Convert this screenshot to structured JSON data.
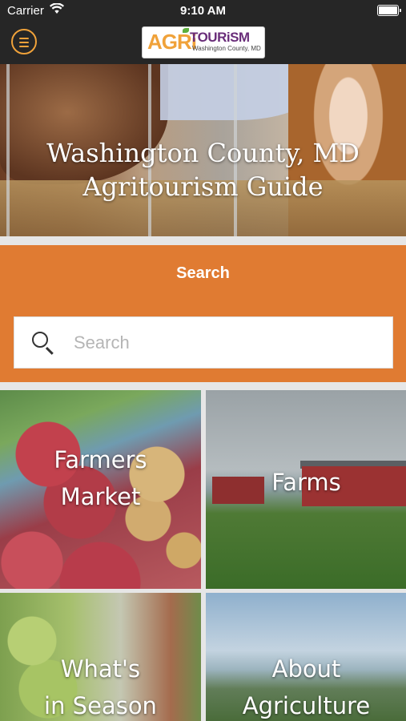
{
  "status_bar": {
    "carrier": "Carrier",
    "time": "9:10 AM"
  },
  "header": {
    "logo": {
      "brand_part1": "AGRi",
      "brand_part2": "TOURiSM",
      "subtitle": "Washington County, MD"
    }
  },
  "hero": {
    "title_line1": "Washington County, MD",
    "title_line2": "Agritourism Guide"
  },
  "search": {
    "heading": "Search",
    "placeholder": "Search",
    "value": ""
  },
  "tiles": [
    {
      "line1": "Farmers",
      "line2": "Market"
    },
    {
      "line1": "Farms"
    },
    {
      "line1": "What's",
      "line2": "in Season"
    },
    {
      "line1": "About",
      "line2": "Agriculture"
    }
  ],
  "colors": {
    "accent": "#e07b32",
    "navbar": "#262626",
    "menu_icon": "#f0a23a"
  },
  "icons": {
    "menu": "hamburger-menu-icon",
    "search": "search-icon",
    "wifi": "wifi-icon",
    "battery": "battery-icon"
  }
}
